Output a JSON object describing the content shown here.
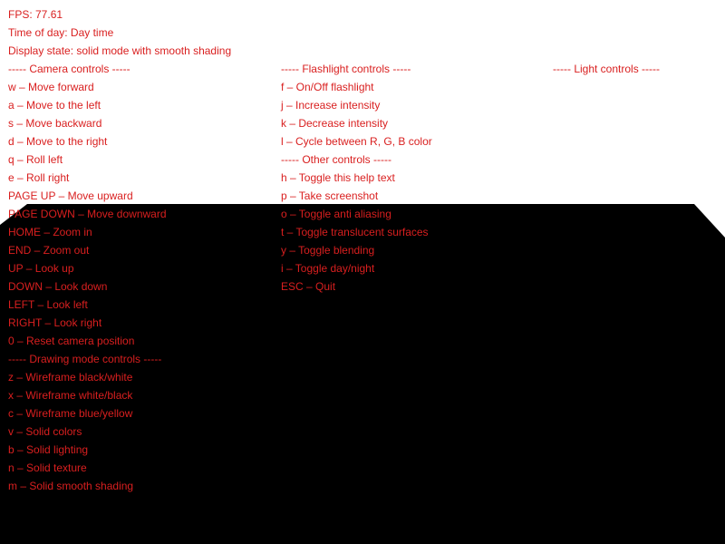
{
  "colors": {
    "hud_text": "#d91f1f",
    "sky": "#ffffff",
    "ground": "#000000"
  },
  "status": {
    "fps": "FPS: 77.61",
    "time_of_day": "Time of day: Day time",
    "display_state": "Display state: solid mode with smooth shading"
  },
  "camera": {
    "header": "----- Camera controls -----",
    "items": [
      "w – Move forward",
      "a – Move to the left",
      "s – Move backward",
      "d – Move to the right",
      "q – Roll left",
      "e – Roll right",
      "PAGE UP – Move upward",
      "PAGE DOWN – Move downward",
      "HOME – Zoom in",
      "END – Zoom out",
      "UP – Look up",
      "DOWN – Look down",
      "LEFT – Look left",
      "RIGHT – Look right",
      "0 – Reset camera position"
    ]
  },
  "drawing": {
    "header": "----- Drawing mode controls -----",
    "items": [
      "z – Wireframe black/white",
      "x – Wireframe white/black",
      "c – Wireframe blue/yellow",
      "v – Solid colors",
      "b – Solid lighting",
      "n – Solid texture",
      "m – Solid smooth shading"
    ]
  },
  "flashlight": {
    "header": "----- Flashlight controls -----",
    "items": [
      "f – On/Off flashlight",
      "j – Increase intensity",
      "k – Decrease intensity",
      "l – Cycle between R, G, B color"
    ]
  },
  "other": {
    "header": "----- Other controls -----",
    "items": [
      "h – Toggle this help text",
      "p – Take screenshot",
      "o – Toggle anti aliasing",
      "t – Toggle translucent surfaces",
      "y – Toggle blending",
      "i – Toggle day/night",
      "ESC – Quit"
    ]
  },
  "light": {
    "header": "----- Light controls -----"
  }
}
